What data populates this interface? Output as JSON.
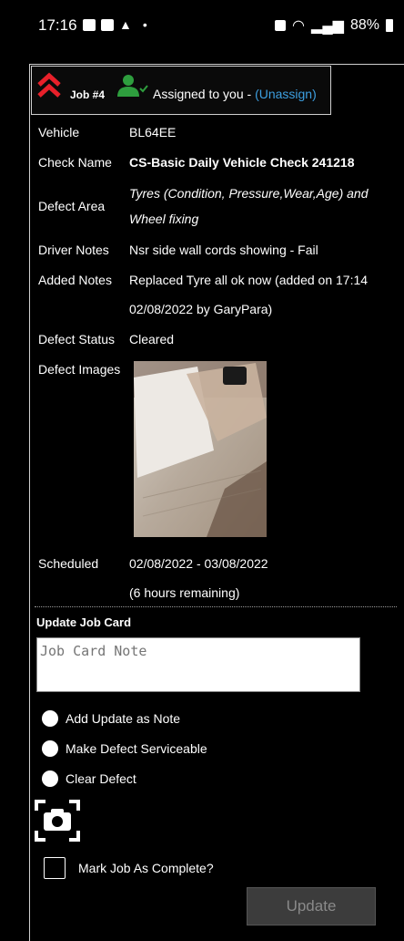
{
  "status_bar": {
    "time": "17:16",
    "battery": "88%"
  },
  "job": {
    "number": "Job #4",
    "assigned_text": "Assigned to you - ",
    "unassign_label": "(Unassign)"
  },
  "details": {
    "vehicle_label": "Vehicle",
    "vehicle_value": "BL64EE",
    "check_name_label": "Check Name",
    "check_name_value": "CS-Basic Daily Vehicle Check 241218",
    "defect_area_label": "Defect Area",
    "defect_area_value": "Tyres (Condition, Pressure,Wear,Age) and Wheel fixing",
    "driver_notes_label": "Driver Notes",
    "driver_notes_value": "Nsr side wall cords showing - Fail",
    "added_notes_label": "Added Notes",
    "added_notes_value": "Replaced Tyre all ok now (added on 17:14 02/08/2022 by GaryPara)",
    "defect_status_label": "Defect Status",
    "defect_status_value": "Cleared",
    "defect_images_label": "Defect Images",
    "scheduled_label": "Scheduled",
    "scheduled_value": "02/08/2022 - 03/08/2022",
    "remaining": "(6 hours remaining)"
  },
  "update": {
    "title": "Update Job Card",
    "note_placeholder": "Job Card Note",
    "options": [
      "Add Update as Note",
      "Make Defect Serviceable",
      "Clear Defect"
    ],
    "complete_label": "Mark Job As Complete?",
    "button_label": "Update"
  },
  "colors": {
    "priority_red": "#e8202a",
    "assignee_green": "#2e9e3e",
    "link_blue": "#3d9fe0"
  }
}
